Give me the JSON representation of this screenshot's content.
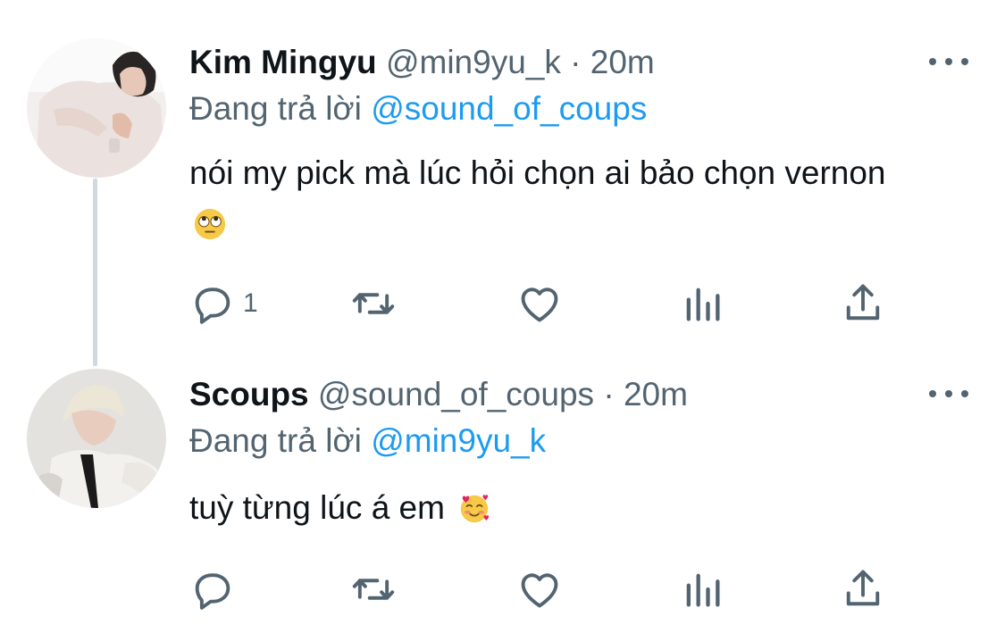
{
  "tweets": [
    {
      "display_name": "Kim Mingyu",
      "handle": "@min9yu_k",
      "separator": "·",
      "time": "20m",
      "reply_prefix": "Đang trả lời",
      "reply_to": "@sound_of_coups",
      "text": "nói my pick mà lúc hỏi chọn ai bảo chọn vernon",
      "emoji": "face-with-rolling-eyes",
      "reply_count": "1"
    },
    {
      "display_name": "Scoups",
      "handle": "@sound_of_coups",
      "separator": "·",
      "time": "20m",
      "reply_prefix": "Đang trả lời",
      "reply_to": "@min9yu_k",
      "text": "tuỳ từng lúc á em",
      "emoji": "smiling-face-with-hearts",
      "reply_count": ""
    }
  ],
  "icons": {
    "reply": "reply-icon",
    "retweet": "retweet-icon",
    "like": "heart-icon",
    "views": "analytics-icon",
    "share": "share-icon",
    "more": "more-icon"
  },
  "colors": {
    "link": "#1d9bf0",
    "secondary_text": "#536471",
    "primary_text": "#0f1419",
    "thread_line": "#cfd9de"
  }
}
